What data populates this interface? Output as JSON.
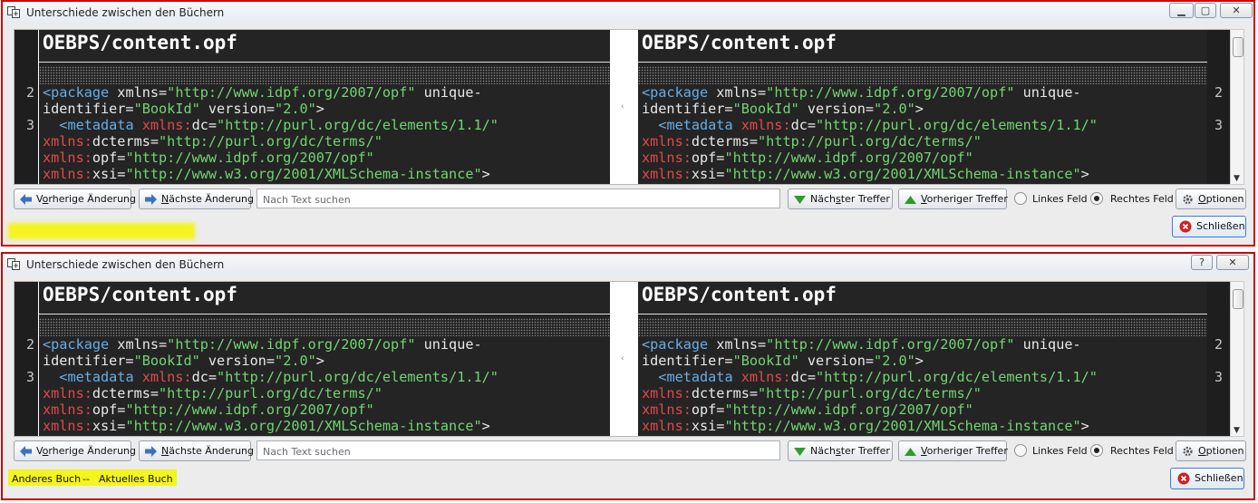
{
  "window_title": "Unterschiede zwischen den Büchern",
  "title_controls": {
    "top": {
      "minimize": "▁",
      "maximize": "▢",
      "close": "✕"
    },
    "bottom": {
      "help": "?",
      "close": "✕"
    }
  },
  "diff": {
    "left_file": "OEBPS/content.opf",
    "right_file": "OEBPS/content.opf",
    "line_numbers": [
      "2",
      "3"
    ],
    "lines": [
      [
        [
          "tag",
          "<package "
        ],
        [
          "",
          "xmlns="
        ],
        [
          "str",
          "\"http://www.idpf.org/2007/opf\""
        ],
        [
          "",
          " unique-"
        ]
      ],
      [
        [
          "",
          "identifier="
        ],
        [
          "str",
          "\"BookId\""
        ],
        [
          "",
          " version="
        ],
        [
          "str",
          "\"2.0\""
        ],
        [
          "",
          ">"
        ]
      ],
      [
        [
          "",
          "  "
        ],
        [
          "tag",
          "<metadata "
        ],
        [
          "ns",
          "xmlns:"
        ],
        [
          "",
          "dc="
        ],
        [
          "str",
          "\"http://purl.org/dc/elements/1.1/\""
        ]
      ],
      [
        [
          "ns",
          "xmlns:"
        ],
        [
          "",
          "dcterms="
        ],
        [
          "str",
          "\"http://purl.org/dc/terms/\""
        ]
      ],
      [
        [
          "ns",
          "xmlns:"
        ],
        [
          "",
          "opf="
        ],
        [
          "str",
          "\"http://www.idpf.org/2007/opf\""
        ]
      ],
      [
        [
          "ns",
          "xmlns:"
        ],
        [
          "",
          "xsi="
        ],
        [
          "str",
          "\"http://www.w3.org/2001/XMLSchema-instance\""
        ],
        [
          "",
          ">"
        ]
      ]
    ]
  },
  "toolbar": {
    "prev_change": {
      "mnemonic": "o",
      "before": "V",
      "after": "rherige Änderung"
    },
    "next_change": {
      "mnemonic": "N",
      "before": "",
      "after": "ächste Änderung"
    },
    "search_placeholder": "Nach Text suchen",
    "next_match": {
      "mnemonic": "s",
      "before": "Näch",
      "after": "ter Treffer"
    },
    "prev_match": {
      "mnemonic": "V",
      "before": "",
      "after": "orheriger Treffer"
    },
    "left_field": "Linkes Feld",
    "right_field": "Rechtes Feld",
    "options": {
      "mnemonic": "O",
      "before": "",
      "after": "ptionen"
    },
    "close": "Schließen"
  },
  "selected_field": "right",
  "bottom_note": {
    "left": "Anderes Buch",
    "sep": "--",
    "right": "Aktuelles Buch"
  },
  "colors": {
    "accent_border": "#d60000",
    "highlight": "#f4f41f",
    "editor_bg": "#242424"
  }
}
